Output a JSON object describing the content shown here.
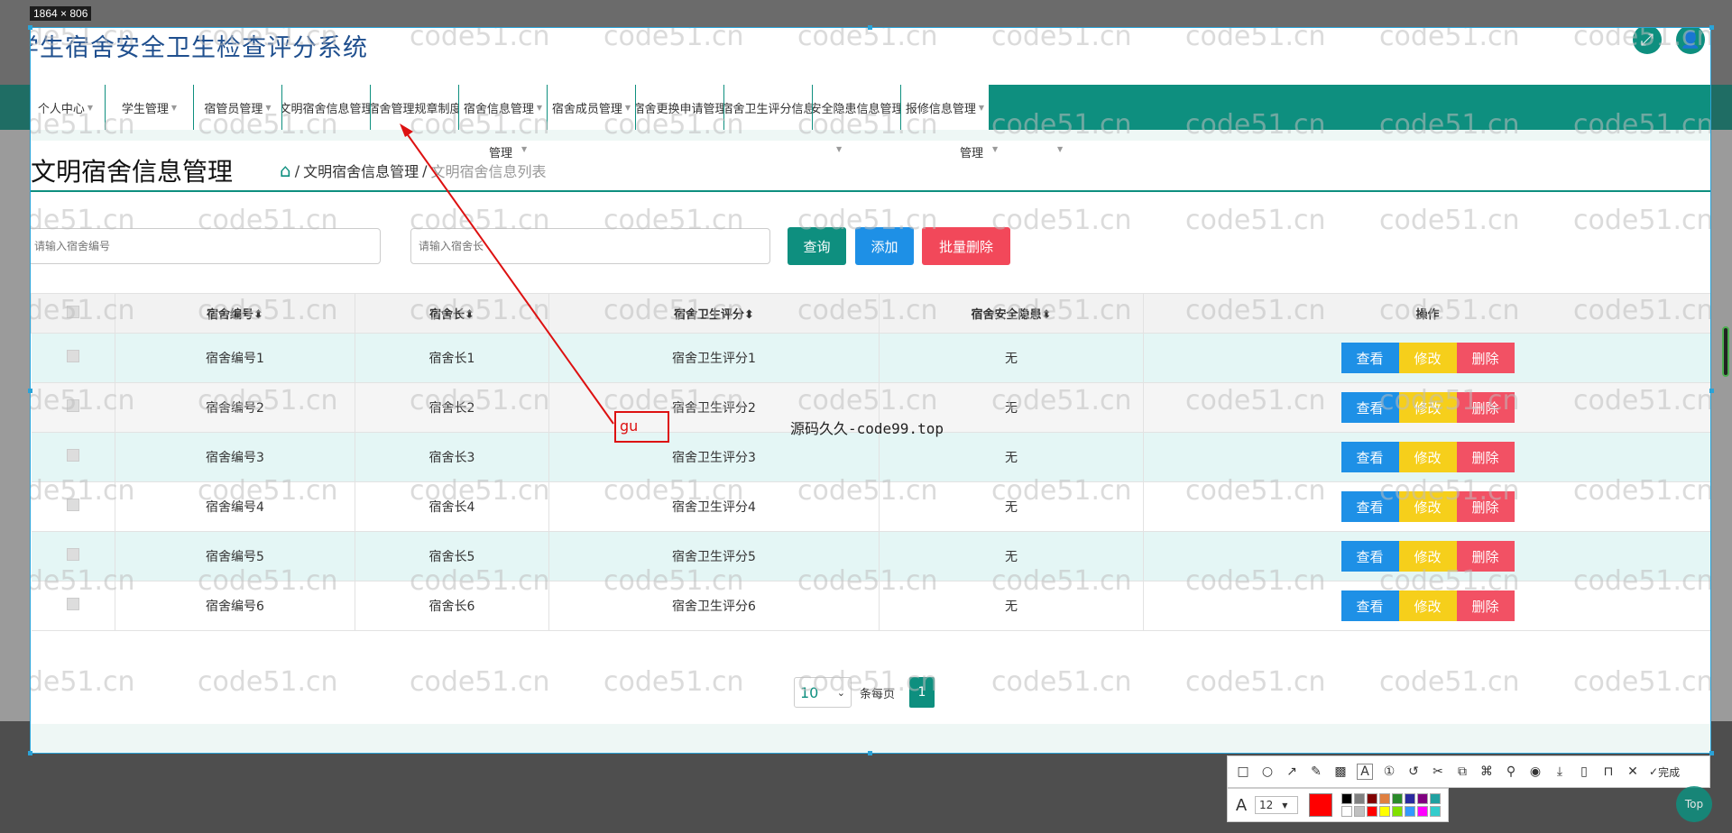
{
  "screenshot_tool": {
    "size_label": "1864 × 806",
    "toolbar_icons": [
      "rect-icon",
      "circle-icon",
      "arrow-icon",
      "pen-icon",
      "mosaic-icon",
      "text-icon",
      "number-icon",
      "undo-icon",
      "cut-icon",
      "ocr-icon",
      "translate-icon",
      "pin-icon",
      "record-icon",
      "save-icon",
      "copy-icon",
      "bookmark-icon",
      "close-icon"
    ],
    "done_label": "完成",
    "font_size": "12",
    "swatches": [
      "#000000",
      "#808080",
      "#800000",
      "#e08040",
      "#2a8a2a",
      "#2a2aa0",
      "#800080",
      "#20a0a0",
      "#ffffff",
      "#c0c0c0",
      "#ff0000",
      "#ffff00",
      "#80e000",
      "#3399ff",
      "#ff00ff",
      "#33cccc"
    ],
    "current_color": "#ff0000"
  },
  "app": {
    "title": "学生宿舍安全卫生检查评分系统",
    "accent": "#0e8f7f"
  },
  "nav": {
    "items": [
      {
        "label": "个人中心",
        "caret": true
      },
      {
        "label": "学生管理",
        "caret": true
      },
      {
        "label": "宿管员管理",
        "caret": true
      },
      {
        "label": "文明宿舍信息管理",
        "caret": false
      },
      {
        "label": "宿舍管理规章制度",
        "caret": false
      },
      {
        "label": "宿舍信息管理",
        "caret": true
      },
      {
        "label": "宿舍成员管理",
        "caret": true
      },
      {
        "label": "宿舍更换申请管理",
        "caret": false
      },
      {
        "label": "宿舍卫生评分信息",
        "caret": false
      },
      {
        "label": "安全隐患信息管理",
        "caret": false
      },
      {
        "label": "报修信息管理",
        "caret": true
      }
    ],
    "sub_labels": [
      "管理",
      "管理"
    ]
  },
  "page": {
    "title": "文明宿舍信息管理",
    "breadcrumb": {
      "sep": "/",
      "current": "文明宿舍信息管理",
      "muted": "文明宿舍信息列表"
    }
  },
  "search": {
    "placeholder_dorm_no": "请输入宿舍编号",
    "placeholder_leader": "请输入宿舍长",
    "query_label": "查询",
    "add_label": "添加",
    "batch_delete_label": "批量删除"
  },
  "table": {
    "headers": [
      "宿舍编号",
      "宿舍长",
      "宿舍卫生评分",
      "宿舍安全隐患",
      "操作"
    ],
    "sort_glyph": "⬍",
    "rows": [
      {
        "dorm_no": "宿舍编号1",
        "leader": "宿舍长1",
        "score": "宿舍卫生评分1",
        "hazard": "无"
      },
      {
        "dorm_no": "宿舍编号2",
        "leader": "宿舍长2",
        "score": "宿舍卫生评分2",
        "hazard": "无"
      },
      {
        "dorm_no": "宿舍编号3",
        "leader": "宿舍长3",
        "score": "宿舍卫生评分3",
        "hazard": "无"
      },
      {
        "dorm_no": "宿舍编号4",
        "leader": "宿舍长4",
        "score": "宿舍卫生评分4",
        "hazard": "无"
      },
      {
        "dorm_no": "宿舍编号5",
        "leader": "宿舍长5",
        "score": "宿舍卫生评分5",
        "hazard": "无"
      },
      {
        "dorm_no": "宿舍编号6",
        "leader": "宿舍长6",
        "score": "宿舍卫生评分6",
        "hazard": "无"
      }
    ],
    "op_view": "查看",
    "op_edit": "修改",
    "op_delete": "删除"
  },
  "pagination": {
    "page_size": "10",
    "per_page_label": "条每页",
    "current_page": "1"
  },
  "annotation": {
    "typed_text": "gu",
    "note": "源码久久-code99.top"
  },
  "watermark": "code51.cn",
  "scroll_top_label": "Top"
}
